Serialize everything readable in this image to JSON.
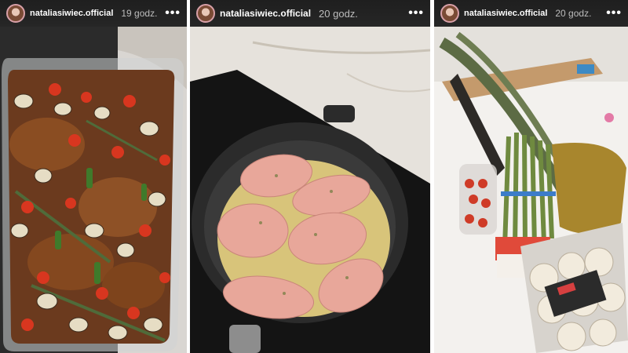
{
  "stories": [
    {
      "username": "nataliasiwiec.official",
      "time": "19 godz.",
      "more": "•••",
      "photo": "roasted-chicken-vegetables-dish"
    },
    {
      "username": "nataliasiwiec.official",
      "time": "20 godz.",
      "more": "•••",
      "photo": "chicken-breasts-in-frying-pan"
    },
    {
      "username": "nataliasiwiec.official",
      "time": "20 godz.",
      "more": "•••",
      "photo": "asparagus-tomatoes-mushrooms-on-counter"
    }
  ],
  "colors": {
    "header_bg": "#222222",
    "avatar_ring": "#d8a0a8",
    "username": "#ffffff",
    "time": "#bdbdbd"
  },
  "icons": [
    "avatar",
    "more-options-icon"
  ]
}
